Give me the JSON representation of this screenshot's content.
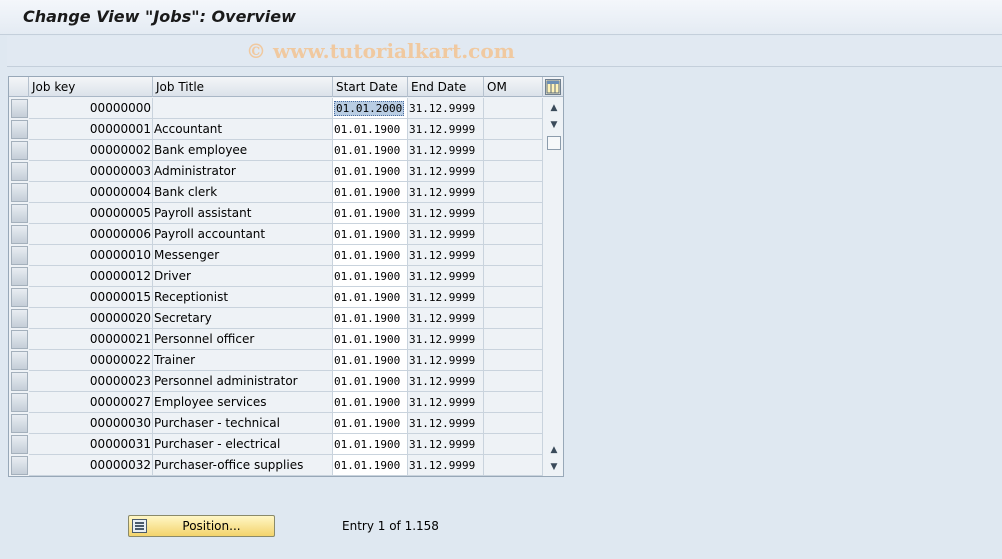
{
  "window": {
    "title": "Change View \"Jobs\": Overview"
  },
  "watermark": "© www.tutorialkart.com",
  "table": {
    "columns": [
      "Job key",
      "Job Title",
      "Start Date",
      "End Date",
      "OM"
    ],
    "rows": [
      {
        "key": "00000000",
        "title": "",
        "start": "01.01.2000",
        "end": "31.12.9999",
        "om": ""
      },
      {
        "key": "00000001",
        "title": "Accountant",
        "start": "01.01.1900",
        "end": "31.12.9999",
        "om": ""
      },
      {
        "key": "00000002",
        "title": "Bank employee",
        "start": "01.01.1900",
        "end": "31.12.9999",
        "om": ""
      },
      {
        "key": "00000003",
        "title": "Administrator",
        "start": "01.01.1900",
        "end": "31.12.9999",
        "om": ""
      },
      {
        "key": "00000004",
        "title": "Bank clerk",
        "start": "01.01.1900",
        "end": "31.12.9999",
        "om": ""
      },
      {
        "key": "00000005",
        "title": "Payroll assistant",
        "start": "01.01.1900",
        "end": "31.12.9999",
        "om": ""
      },
      {
        "key": "00000006",
        "title": "Payroll accountant",
        "start": "01.01.1900",
        "end": "31.12.9999",
        "om": ""
      },
      {
        "key": "00000010",
        "title": "Messenger",
        "start": "01.01.1900",
        "end": "31.12.9999",
        "om": ""
      },
      {
        "key": "00000012",
        "title": "Driver",
        "start": "01.01.1900",
        "end": "31.12.9999",
        "om": ""
      },
      {
        "key": "00000015",
        "title": "Receptionist",
        "start": "01.01.1900",
        "end": "31.12.9999",
        "om": ""
      },
      {
        "key": "00000020",
        "title": "Secretary",
        "start": "01.01.1900",
        "end": "31.12.9999",
        "om": ""
      },
      {
        "key": "00000021",
        "title": "Personnel officer",
        "start": "01.01.1900",
        "end": "31.12.9999",
        "om": ""
      },
      {
        "key": "00000022",
        "title": "Trainer",
        "start": "01.01.1900",
        "end": "31.12.9999",
        "om": ""
      },
      {
        "key": "00000023",
        "title": "Personnel administrator",
        "start": "01.01.1900",
        "end": "31.12.9999",
        "om": ""
      },
      {
        "key": "00000027",
        "title": "Employee services",
        "start": "01.01.1900",
        "end": "31.12.9999",
        "om": ""
      },
      {
        "key": "00000030",
        "title": "Purchaser - technical",
        "start": "01.01.1900",
        "end": "31.12.9999",
        "om": ""
      },
      {
        "key": "00000031",
        "title": "Purchaser - electrical",
        "start": "01.01.1900",
        "end": "31.12.9999",
        "om": ""
      },
      {
        "key": "00000032",
        "title": "Purchaser-office supplies",
        "start": "01.01.1900",
        "end": "31.12.9999",
        "om": ""
      }
    ],
    "selected_row": 0
  },
  "footer": {
    "position_button": "Position...",
    "entry_text": "Entry 1 of 1.158"
  },
  "icons": {
    "table_settings": "table-settings-icon",
    "position": "position-icon",
    "scroll_up": "scroll-up-icon",
    "scroll_down": "scroll-down-icon"
  },
  "colors": {
    "background": "#dfe8f1",
    "selected_cell": "#b9cde3",
    "button_yellow": "#f3d36c"
  }
}
